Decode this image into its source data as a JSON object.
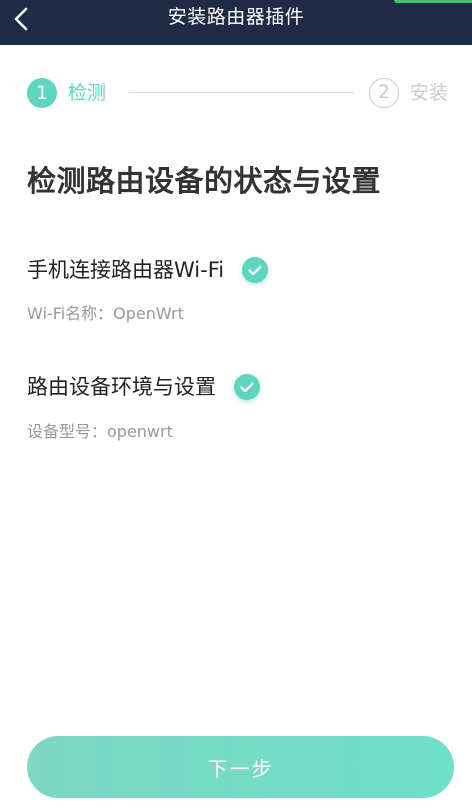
{
  "header": {
    "title": "安装路由器插件",
    "back_icon": "chevron-left-icon",
    "background": "#1f2a45"
  },
  "stepper": {
    "steps": [
      {
        "number": "1",
        "label": "检测",
        "state": "active"
      },
      {
        "number": "2",
        "label": "安装",
        "state": "inactive"
      }
    ],
    "active_color": "#5ed5c1",
    "inactive_color": "#cccccc"
  },
  "main": {
    "title": "检测路由设备的状态与设置",
    "checks": [
      {
        "title": "手机连接路由器Wi-Fi",
        "detail": "Wi-Fi名称：OpenWrt",
        "status": "passed",
        "icon": "check-icon"
      },
      {
        "title": "路由设备环境与设置",
        "detail": "设备型号：openwrt",
        "status": "passed",
        "icon": "check-icon"
      }
    ]
  },
  "footer": {
    "next_label": "下一步"
  }
}
